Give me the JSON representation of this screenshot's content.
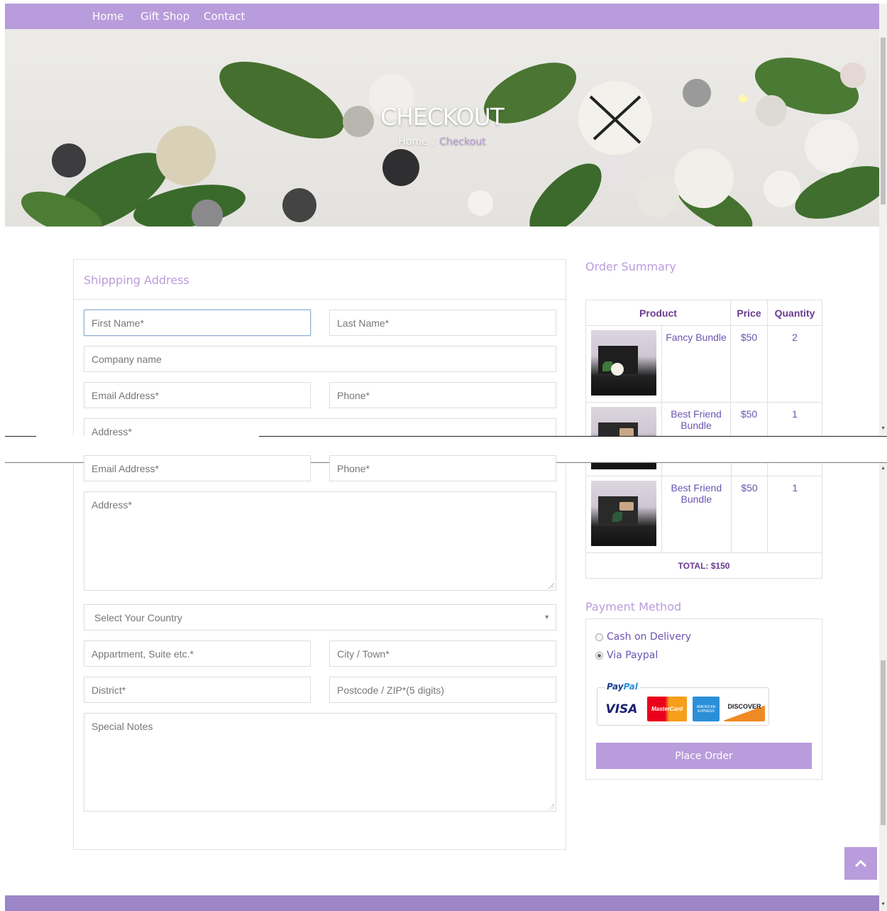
{
  "nav": {
    "items": [
      "Home",
      "Gift Shop",
      "Contact"
    ]
  },
  "hero": {
    "title": "CHECKOUT",
    "crumb_home": "Home",
    "crumb_sep": "/",
    "crumb_current": "Checkout"
  },
  "shipping": {
    "title": "Shippping Address",
    "first_name": "First Name*",
    "last_name": "Last Name*",
    "company": "Company name",
    "email": "Email Address*",
    "phone": "Phone*",
    "address": "Address*",
    "country": "Select Your Country",
    "apartment": "Appartment, Suite etc.*",
    "city": "City / Town*",
    "district": "District*",
    "postcode": "Postcode / ZIP*(5 digits)",
    "notes": "Special Notes"
  },
  "order": {
    "title": "Order Summary",
    "headers": {
      "product": "Product",
      "price": "Price",
      "quantity": "Quantity"
    },
    "rows": [
      {
        "name": "Fancy Bundle",
        "price": "$50",
        "qty": "2"
      },
      {
        "name": "Best Friend Bundle",
        "price": "$50",
        "qty": "1"
      },
      {
        "name": "Best Friend Bundle",
        "price": "$50",
        "qty": "1"
      }
    ],
    "total": "TOTAL: $150"
  },
  "payment": {
    "title": "Payment Method",
    "options": [
      "Cash on Delivery",
      "Via Paypal"
    ],
    "selected": "Via Paypal",
    "paypal_logo_a": "Pay",
    "paypal_logo_b": "Pal",
    "cards": [
      "VISA",
      "MasterCard",
      "AMERICAN EXPRESS",
      "DISCOVER"
    ],
    "place_order": "Place Order"
  },
  "colors": {
    "accent": "#b99cdb",
    "link": "#6b55b0",
    "heading": "#6a3a8f"
  },
  "icons": {
    "to_top": "chevron-up-icon"
  }
}
